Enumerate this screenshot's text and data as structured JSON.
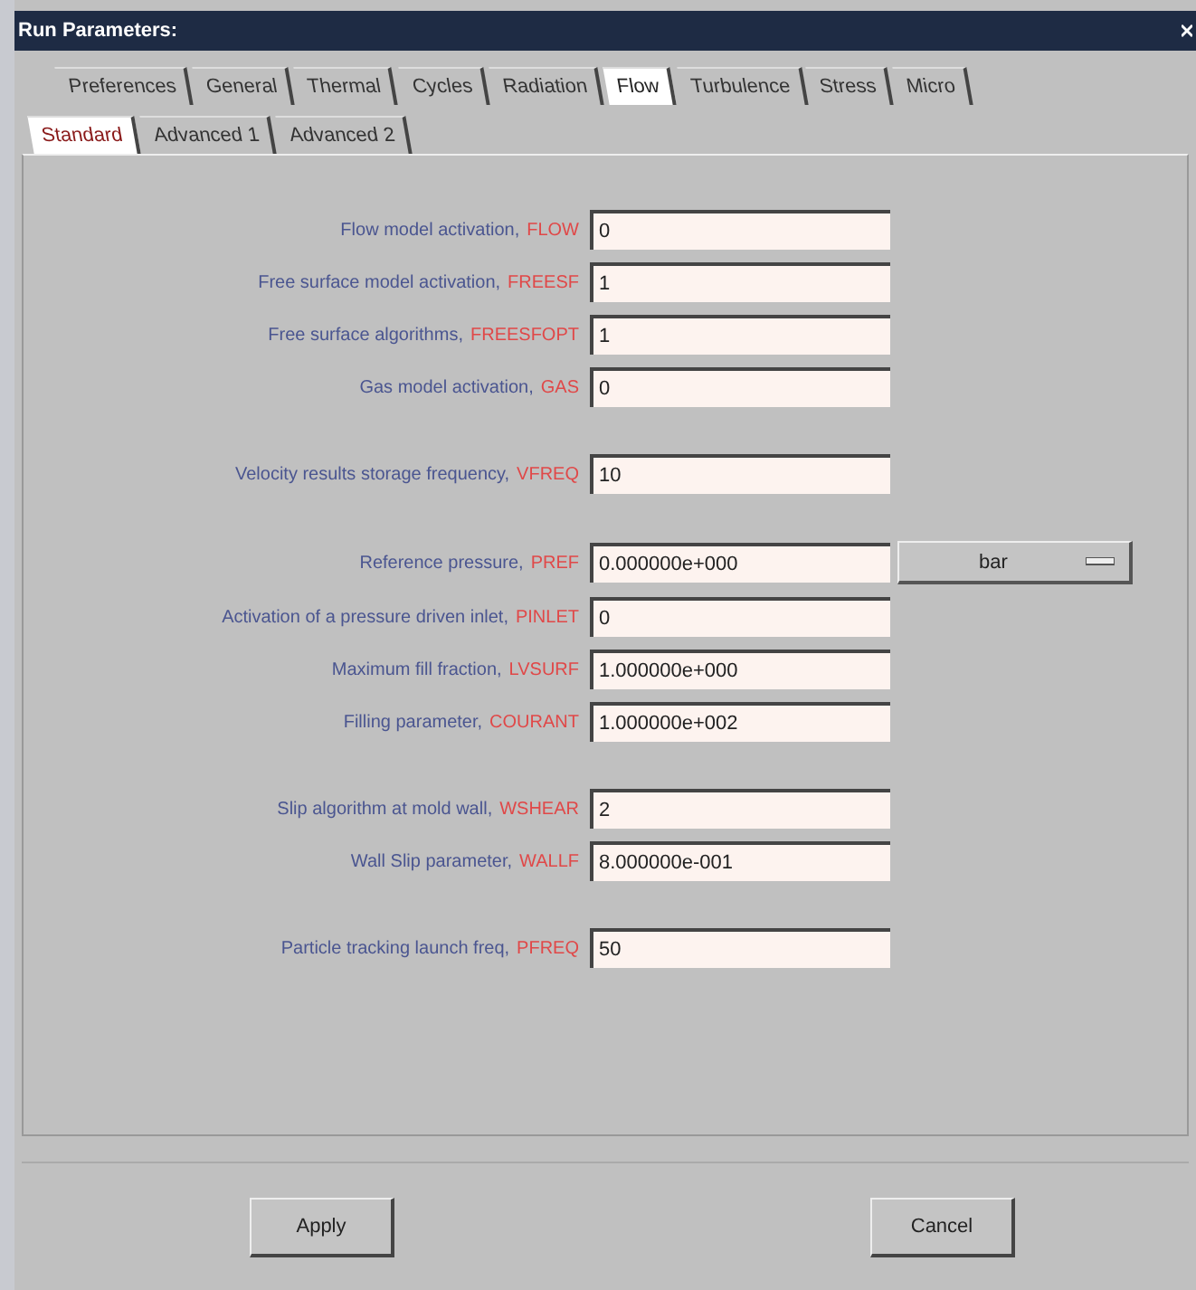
{
  "window": {
    "title": "Run Parameters:"
  },
  "tabs": [
    {
      "label": "Preferences",
      "selected": false
    },
    {
      "label": "General",
      "selected": false
    },
    {
      "label": "Thermal",
      "selected": false
    },
    {
      "label": "Cycles",
      "selected": false
    },
    {
      "label": "Radiation",
      "selected": false
    },
    {
      "label": "Flow",
      "selected": true
    },
    {
      "label": "Turbulence",
      "selected": false
    },
    {
      "label": "Stress",
      "selected": false
    },
    {
      "label": "Micro",
      "selected": false
    }
  ],
  "subtabs": [
    {
      "label": "Standard",
      "selected": true
    },
    {
      "label": "Advanced 1",
      "selected": false
    },
    {
      "label": "Advanced 2",
      "selected": false
    }
  ],
  "groups": [
    {
      "params": [
        {
          "label": "Flow model activation,",
          "code": "FLOW",
          "value": "0"
        },
        {
          "label": "Free surface model activation,",
          "code": "FREESF",
          "value": "1"
        },
        {
          "label": "Free surface algorithms,",
          "code": "FREESFOPT",
          "value": "1"
        },
        {
          "label": "Gas model activation,",
          "code": "GAS",
          "value": "0"
        }
      ]
    },
    {
      "params": [
        {
          "label": "Velocity results storage frequency,",
          "code": "VFREQ",
          "value": "10"
        }
      ]
    },
    {
      "params": [
        {
          "label": "Reference pressure,",
          "code": "PREF",
          "value": "0.000000e+000",
          "unit": "bar"
        },
        {
          "label": "Activation of a pressure driven inlet,",
          "code": "PINLET",
          "value": "0"
        },
        {
          "label": "Maximum fill fraction,",
          "code": "LVSURF",
          "value": "1.000000e+000"
        },
        {
          "label": "Filling parameter,",
          "code": "COURANT",
          "value": "1.000000e+002"
        }
      ]
    },
    {
      "params": [
        {
          "label": "Slip algorithm at mold wall,",
          "code": "WSHEAR",
          "value": "2"
        },
        {
          "label": "Wall Slip parameter,",
          "code": "WALLF",
          "value": "8.000000e-001"
        }
      ]
    },
    {
      "params": [
        {
          "label": "Particle tracking launch freq,",
          "code": "PFREQ",
          "value": "50"
        }
      ]
    }
  ],
  "buttons": [
    "Apply",
    "Cancel"
  ]
}
